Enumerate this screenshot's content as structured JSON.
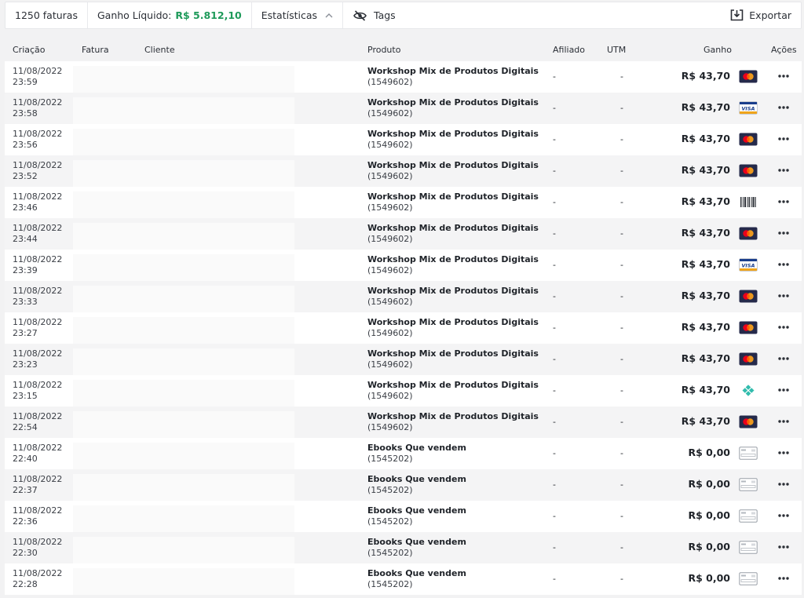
{
  "toolbar": {
    "invoice_count": "1250 faturas",
    "net_label": "Ganho Líquido:",
    "net_value": "R$ 5.812,10",
    "stats_label": "Estatísticas",
    "tags_label": "Tags",
    "export_label": "Exportar"
  },
  "table": {
    "headers": {
      "created": "Criação",
      "invoice": "Fatura",
      "client": "Cliente",
      "product": "Produto",
      "affiliate": "Afiliado",
      "utm": "UTM",
      "earning": "Ganho",
      "actions": "Ações"
    },
    "rows": [
      {
        "date": "11/08/2022",
        "time": "23:59",
        "product": "Workshop Mix de Produtos Digitais",
        "product_id": "(1549602)",
        "affiliate": "-",
        "utm": "-",
        "earning": "R$ 43,70",
        "payment": "mastercard-icon"
      },
      {
        "date": "11/08/2022",
        "time": "23:58",
        "product": "Workshop Mix de Produtos Digitais",
        "product_id": "(1549602)",
        "affiliate": "-",
        "utm": "-",
        "earning": "R$ 43,70",
        "payment": "visa-icon"
      },
      {
        "date": "11/08/2022",
        "time": "23:56",
        "product": "Workshop Mix de Produtos Digitais",
        "product_id": "(1549602)",
        "affiliate": "-",
        "utm": "-",
        "earning": "R$ 43,70",
        "payment": "mastercard-icon"
      },
      {
        "date": "11/08/2022",
        "time": "23:52",
        "product": "Workshop Mix de Produtos Digitais",
        "product_id": "(1549602)",
        "affiliate": "-",
        "utm": "-",
        "earning": "R$ 43,70",
        "payment": "mastercard-icon"
      },
      {
        "date": "11/08/2022",
        "time": "23:46",
        "product": "Workshop Mix de Produtos Digitais",
        "product_id": "(1549602)",
        "affiliate": "-",
        "utm": "-",
        "earning": "R$ 43,70",
        "payment": "barcode-icon"
      },
      {
        "date": "11/08/2022",
        "time": "23:44",
        "product": "Workshop Mix de Produtos Digitais",
        "product_id": "(1549602)",
        "affiliate": "-",
        "utm": "-",
        "earning": "R$ 43,70",
        "payment": "mastercard-icon"
      },
      {
        "date": "11/08/2022",
        "time": "23:39",
        "product": "Workshop Mix de Produtos Digitais",
        "product_id": "(1549602)",
        "affiliate": "-",
        "utm": "-",
        "earning": "R$ 43,70",
        "payment": "visa-icon"
      },
      {
        "date": "11/08/2022",
        "time": "23:33",
        "product": "Workshop Mix de Produtos Digitais",
        "product_id": "(1549602)",
        "affiliate": "-",
        "utm": "-",
        "earning": "R$ 43,70",
        "payment": "mastercard-icon"
      },
      {
        "date": "11/08/2022",
        "time": "23:27",
        "product": "Workshop Mix de Produtos Digitais",
        "product_id": "(1549602)",
        "affiliate": "-",
        "utm": "-",
        "earning": "R$ 43,70",
        "payment": "mastercard-icon"
      },
      {
        "date": "11/08/2022",
        "time": "23:23",
        "product": "Workshop Mix de Produtos Digitais",
        "product_id": "(1549602)",
        "affiliate": "-",
        "utm": "-",
        "earning": "R$ 43,70",
        "payment": "mastercard-icon"
      },
      {
        "date": "11/08/2022",
        "time": "23:15",
        "product": "Workshop Mix de Produtos Digitais",
        "product_id": "(1549602)",
        "affiliate": "-",
        "utm": "-",
        "earning": "R$ 43,70",
        "payment": "pix-icon"
      },
      {
        "date": "11/08/2022",
        "time": "22:54",
        "product": "Workshop Mix de Produtos Digitais",
        "product_id": "(1549602)",
        "affiliate": "-",
        "utm": "-",
        "earning": "R$ 43,70",
        "payment": "mastercard-icon"
      },
      {
        "date": "11/08/2022",
        "time": "22:40",
        "product": "Ebooks Que vendem",
        "product_id": "(1545202)",
        "affiliate": "-",
        "utm": "-",
        "earning": "R$ 0,00",
        "payment": "generic-card-icon"
      },
      {
        "date": "11/08/2022",
        "time": "22:37",
        "product": "Ebooks Que vendem",
        "product_id": "(1545202)",
        "affiliate": "-",
        "utm": "-",
        "earning": "R$ 0,00",
        "payment": "generic-card-icon"
      },
      {
        "date": "11/08/2022",
        "time": "22:36",
        "product": "Ebooks Que vendem",
        "product_id": "(1545202)",
        "affiliate": "-",
        "utm": "-",
        "earning": "R$ 0,00",
        "payment": "generic-card-icon"
      },
      {
        "date": "11/08/2022",
        "time": "22:30",
        "product": "Ebooks Que vendem",
        "product_id": "(1545202)",
        "affiliate": "-",
        "utm": "-",
        "earning": "R$ 0,00",
        "payment": "generic-card-icon"
      },
      {
        "date": "11/08/2022",
        "time": "22:28",
        "product": "Ebooks Que vendem",
        "product_id": "(1545202)",
        "affiliate": "-",
        "utm": "-",
        "earning": "R$ 0,00",
        "payment": "generic-card-icon"
      }
    ]
  },
  "colors": {
    "accent_green": "#1e9a5a",
    "row_alt": "#f4f4f5",
    "background": "#f2f2f3"
  }
}
